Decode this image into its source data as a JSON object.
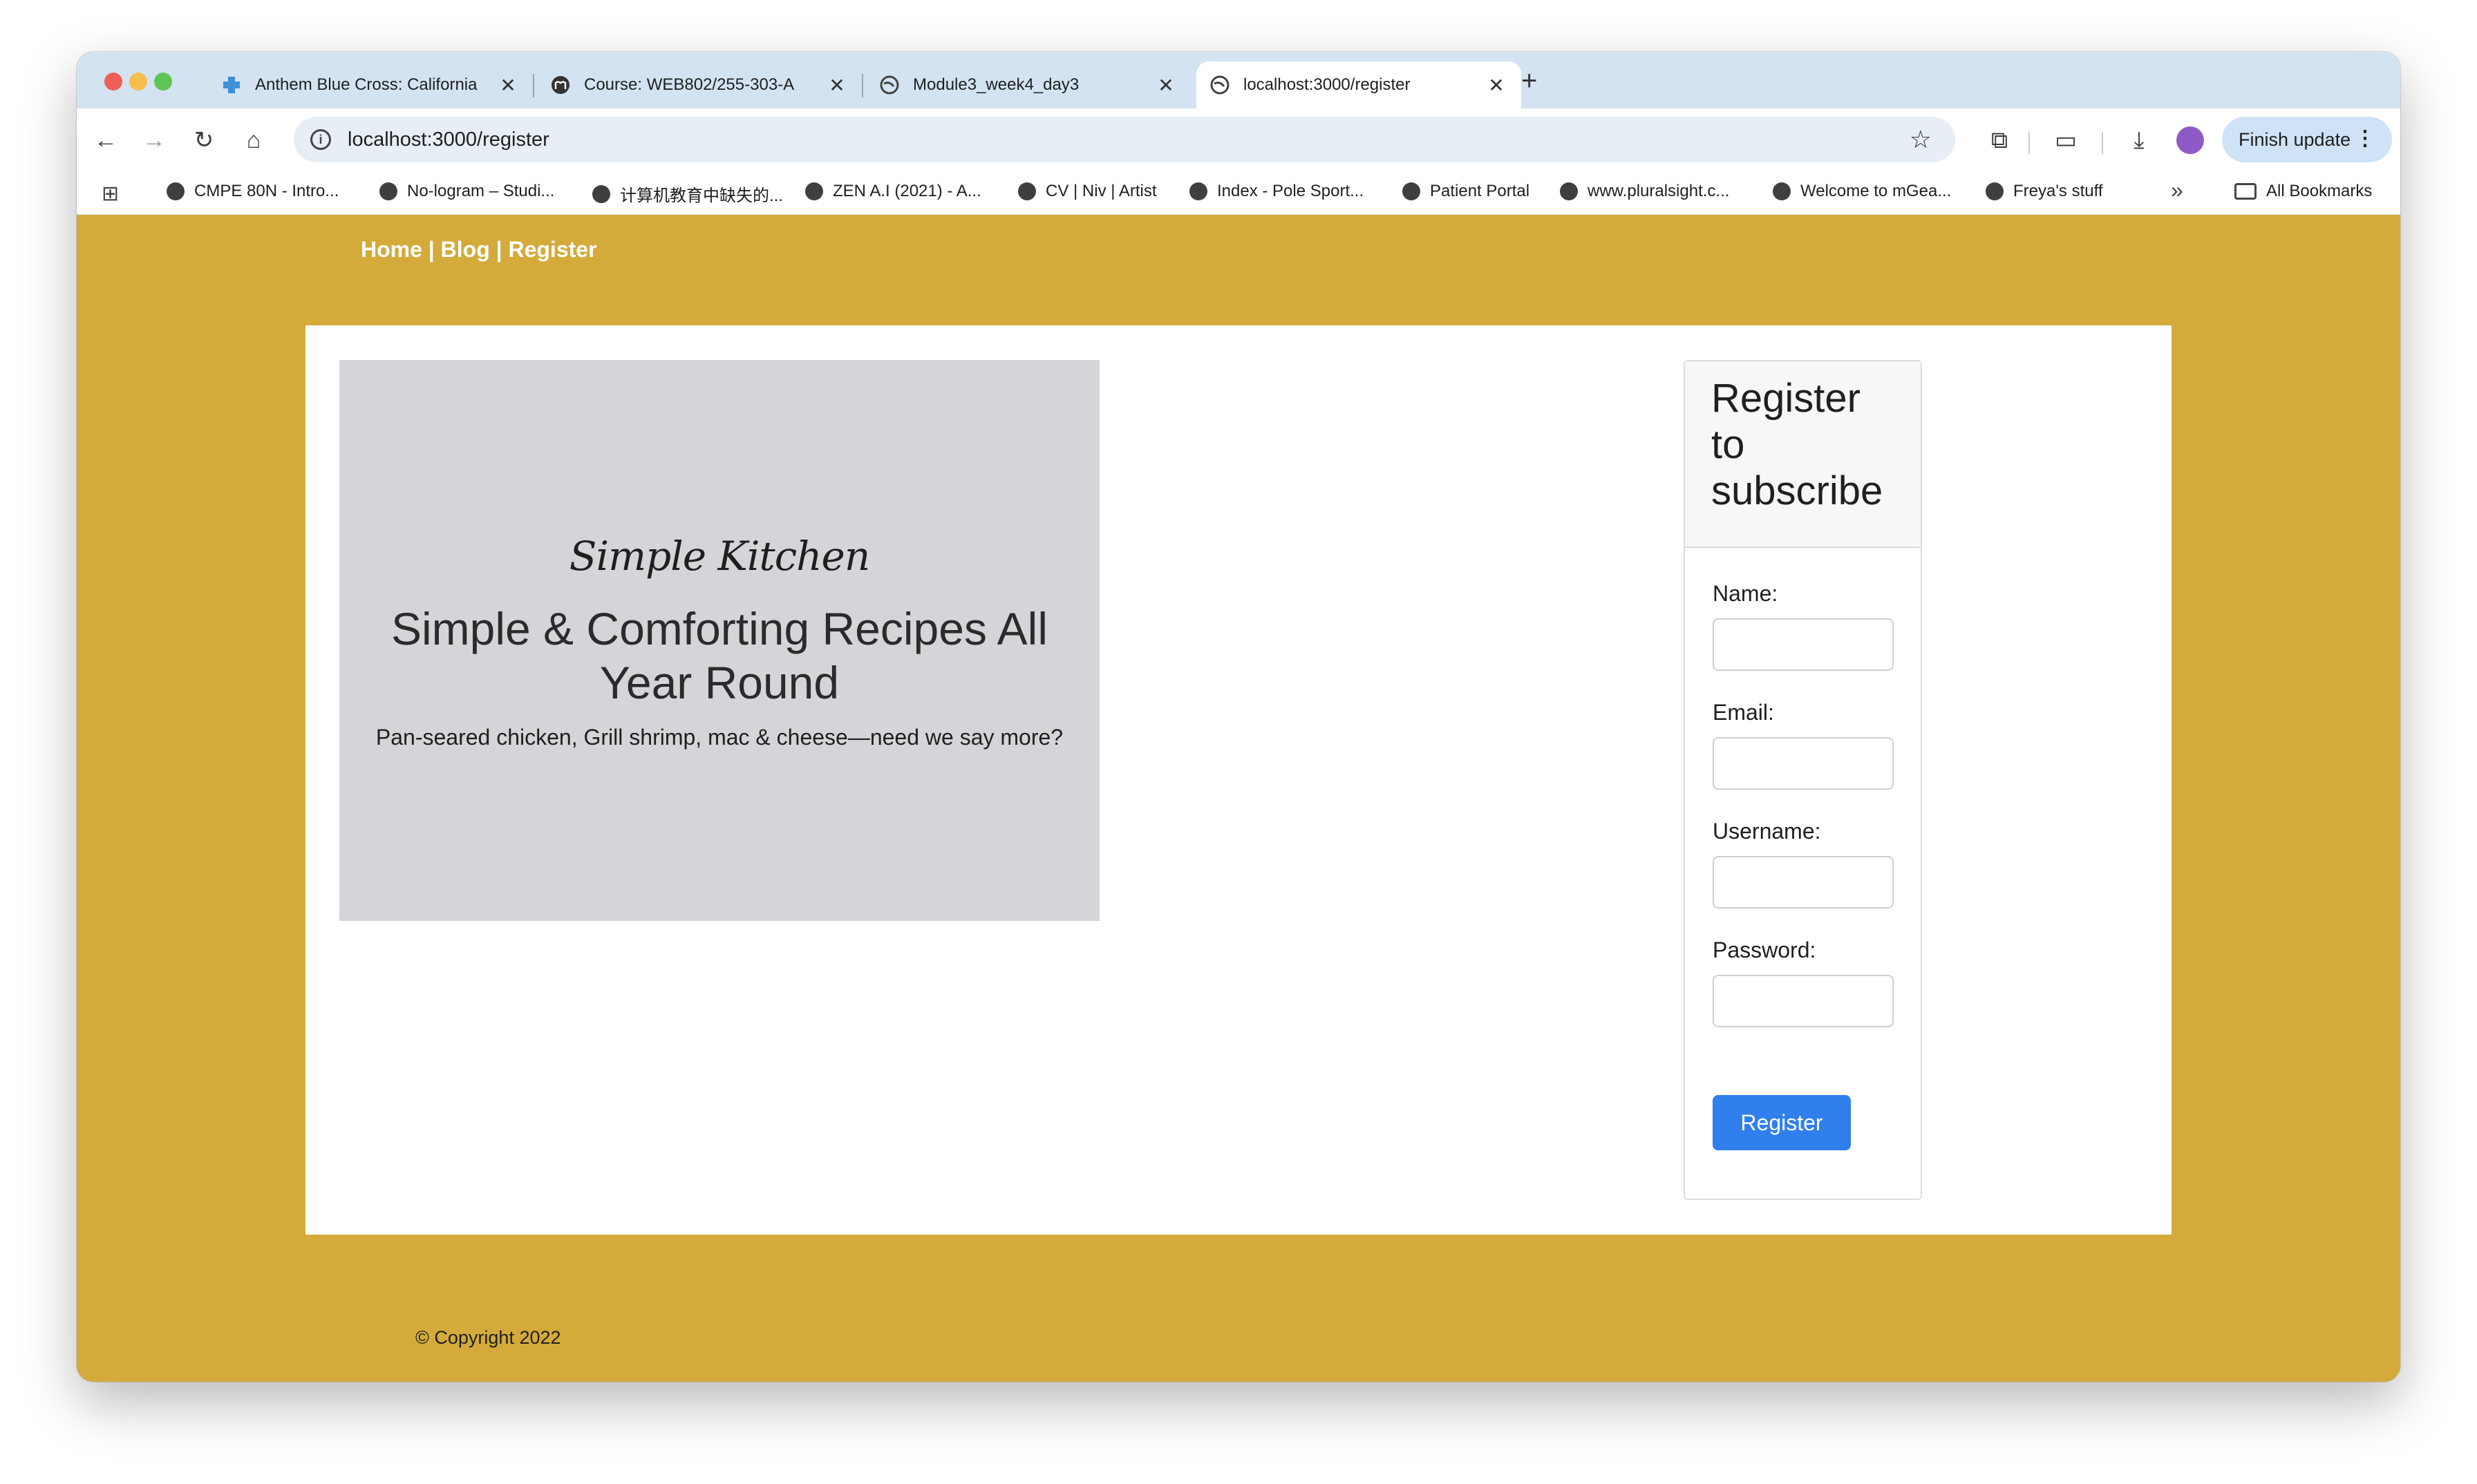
{
  "browser": {
    "tabs": [
      {
        "title": "Anthem Blue Cross: California"
      },
      {
        "title": "Course: WEB802/255-303-A"
      },
      {
        "title": "Module3_week4_day3"
      },
      {
        "title": "localhost:3000/register"
      }
    ],
    "close_glyph": "✕",
    "new_tab": "+",
    "url": "localhost:3000/register",
    "finish_update": "Finish update",
    "bookmarks": [
      "CMPE 80N - Intro...",
      "No-logram – Studi...",
      "计算机教育中缺失的...",
      "ZEN A.I (2021) - A...",
      "CV | Niv | Artist",
      "Index - Pole Sport...",
      "Patient Portal",
      "www.pluralsight.c...",
      "Welcome to mGea...",
      "Freya's stuff"
    ],
    "all_bookmarks": "All Bookmarks"
  },
  "nav": {
    "home": "Home",
    "sep1": " | ",
    "blog": "Blog",
    "sep2": " | ",
    "register": "Register"
  },
  "hero": {
    "script": "Simple Kitchen",
    "title": "Simple & Comforting Recipes All Year Round",
    "subtitle": "Pan-seared chicken, Grill shrimp, mac & cheese—need we say more?"
  },
  "form": {
    "heading": "Register to subscribe",
    "name_label": "Name:",
    "email_label": "Email:",
    "username_label": "Username:",
    "password_label": "Password:",
    "submit": "Register"
  },
  "footer": {
    "copyright": "© Copyright 2022"
  },
  "colors": {
    "page_bg": "#d4ab3a",
    "hero_bg": "#d4d5d8",
    "button": "#2f80ed"
  }
}
